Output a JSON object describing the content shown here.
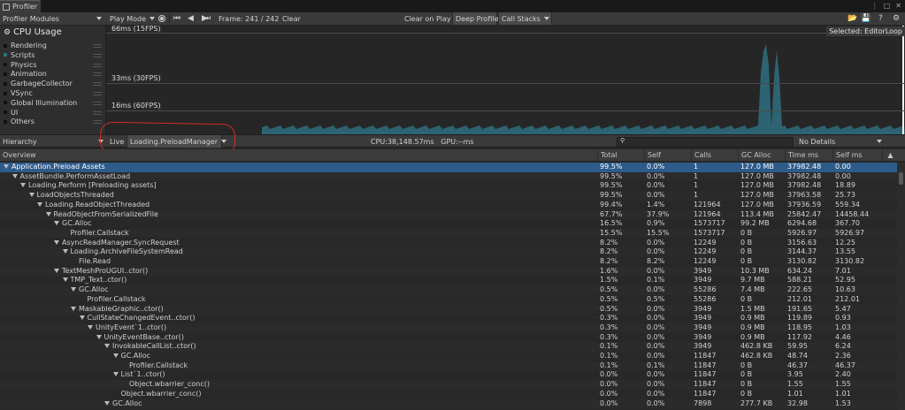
{
  "window": {
    "tab_title": "Profiler"
  },
  "toolbar": {
    "modules_label": "Profiler Modules",
    "play_mode_label": "Play Mode",
    "frame_label": "Frame: 241 / 242",
    "clear_label": "Clear",
    "clear_on_play_label": "Clear on Play",
    "deep_profile_label": "Deep Profile",
    "call_stacks_label": "Call Stacks"
  },
  "cpu_panel": {
    "title": "CPU Usage",
    "legend": [
      "Rendering",
      "Scripts",
      "Physics",
      "Animation",
      "GarbageCollector",
      "VSync",
      "Global Illumination",
      "UI",
      "Others"
    ]
  },
  "graph": {
    "label_66": "66ms (15FPS)",
    "label_33": "33ms (30FPS)",
    "label_16": "16ms (60FPS)",
    "selected_label": "Selected: EditorLoop",
    "bar_color": "#2f6f80"
  },
  "hierarchy_toolbar": {
    "view_label": "Hierarchy",
    "live_label": "Live",
    "thread_label": "Loading.PreloadManager",
    "cpu_stat": "CPU:38,148.57ms   GPU:--ms",
    "details_label": "No Details"
  },
  "columns": [
    "Overview",
    "Total",
    "Self",
    "Calls",
    "GC Alloc",
    "Time ms",
    "Self ms"
  ],
  "rows": [
    {
      "name": "Application.Preload Assets",
      "level": 0,
      "arrow": true,
      "total": "99.5%",
      "self": "0.0%",
      "calls": "1",
      "gc": "127.0 MB",
      "time": "37982.48",
      "selfms": "0.00"
    },
    {
      "name": "AssetBundle.PerformAssetLoad",
      "level": 1,
      "arrow": true,
      "total": "99.5%",
      "self": "0.0%",
      "calls": "1",
      "gc": "127.0 MB",
      "time": "37982.48",
      "selfms": "0.00"
    },
    {
      "name": "Loading.Perform [Preloading assets]",
      "level": 2,
      "arrow": true,
      "total": "99.5%",
      "self": "0.0%",
      "calls": "1",
      "gc": "127.0 MB",
      "time": "37982.48",
      "selfms": "18.89"
    },
    {
      "name": "LoadObjectsThreaded",
      "level": 3,
      "arrow": true,
      "total": "99.5%",
      "self": "0.0%",
      "calls": "1",
      "gc": "127.0 MB",
      "time": "37963.58",
      "selfms": "25.73"
    },
    {
      "name": "Loading.ReadObjectThreaded",
      "level": 4,
      "arrow": true,
      "total": "99.4%",
      "self": "1.4%",
      "calls": "121964",
      "gc": "127.0 MB",
      "time": "37936.59",
      "selfms": "559.34"
    },
    {
      "name": "ReadObjectFromSerializedFile",
      "level": 5,
      "arrow": true,
      "total": "67.7%",
      "self": "37.9%",
      "calls": "121964",
      "gc": "113.4 MB",
      "time": "25842.47",
      "selfms": "14458.44"
    },
    {
      "name": "GC.Alloc",
      "level": 6,
      "arrow": true,
      "total": "16.5%",
      "self": "0.9%",
      "calls": "1573717",
      "gc": "99.2 MB",
      "time": "6294.68",
      "selfms": "367.70"
    },
    {
      "name": "Profiler.Callstack",
      "level": 7,
      "arrow": false,
      "total": "15.5%",
      "self": "15.5%",
      "calls": "1573717",
      "gc": "0 B",
      "time": "5926.97",
      "selfms": "5926.97"
    },
    {
      "name": "AsyncReadManager.SyncRequest",
      "level": 6,
      "arrow": true,
      "total": "8.2%",
      "self": "0.0%",
      "calls": "12249",
      "gc": "0 B",
      "time": "3156.63",
      "selfms": "12.25"
    },
    {
      "name": "Loading.ArchiveFileSystemRead",
      "level": 7,
      "arrow": true,
      "total": "8.2%",
      "self": "0.0%",
      "calls": "12249",
      "gc": "0 B",
      "time": "3144.37",
      "selfms": "13.55"
    },
    {
      "name": "File.Read",
      "level": 8,
      "arrow": false,
      "total": "8.2%",
      "self": "8.2%",
      "calls": "12249",
      "gc": "0 B",
      "time": "3130.82",
      "selfms": "3130.82"
    },
    {
      "name": "TextMeshProUGUI..ctor()",
      "level": 6,
      "arrow": true,
      "total": "1.6%",
      "self": "0.0%",
      "calls": "3949",
      "gc": "10.3 MB",
      "time": "634.24",
      "selfms": "7.01"
    },
    {
      "name": "TMP_Text..ctor()",
      "level": 7,
      "arrow": true,
      "total": "1.5%",
      "self": "0.1%",
      "calls": "3949",
      "gc": "9.7 MB",
      "time": "588.21",
      "selfms": "52.95"
    },
    {
      "name": "GC.Alloc",
      "level": 8,
      "arrow": true,
      "total": "0.5%",
      "self": "0.0%",
      "calls": "55286",
      "gc": "7.4 MB",
      "time": "222.65",
      "selfms": "10.63"
    },
    {
      "name": "Profiler.Callstack",
      "level": 9,
      "arrow": false,
      "total": "0.5%",
      "self": "0.5%",
      "calls": "55286",
      "gc": "0 B",
      "time": "212.01",
      "selfms": "212.01"
    },
    {
      "name": "MaskableGraphic..ctor()",
      "level": 8,
      "arrow": true,
      "total": "0.5%",
      "self": "0.0%",
      "calls": "3949",
      "gc": "1.5 MB",
      "time": "191.65",
      "selfms": "5.47"
    },
    {
      "name": "CullStateChangedEvent..ctor()",
      "level": 9,
      "arrow": true,
      "total": "0.3%",
      "self": "0.0%",
      "calls": "3949",
      "gc": "0.9 MB",
      "time": "119.89",
      "selfms": "0.93"
    },
    {
      "name": "UnityEvent`1..ctor()",
      "level": 10,
      "arrow": true,
      "total": "0.3%",
      "self": "0.0%",
      "calls": "3949",
      "gc": "0.9 MB",
      "time": "118.95",
      "selfms": "1.03"
    },
    {
      "name": "UnityEventBase..ctor()",
      "level": 11,
      "arrow": true,
      "total": "0.3%",
      "self": "0.0%",
      "calls": "3949",
      "gc": "0.9 MB",
      "time": "117.92",
      "selfms": "4.46"
    },
    {
      "name": "InvokableCallList..ctor()",
      "level": 12,
      "arrow": true,
      "total": "0.1%",
      "self": "0.0%",
      "calls": "3949",
      "gc": "462.8 KB",
      "time": "59.95",
      "selfms": "6.24"
    },
    {
      "name": "GC.Alloc",
      "level": 13,
      "arrow": true,
      "total": "0.1%",
      "self": "0.0%",
      "calls": "11847",
      "gc": "462.8 KB",
      "time": "48.74",
      "selfms": "2.36"
    },
    {
      "name": "Profiler.Callstack",
      "level": 14,
      "arrow": false,
      "total": "0.1%",
      "self": "0.1%",
      "calls": "11847",
      "gc": "0 B",
      "time": "46.37",
      "selfms": "46.37"
    },
    {
      "name": "List`1..ctor()",
      "level": 13,
      "arrow": true,
      "total": "0.0%",
      "self": "0.0%",
      "calls": "11847",
      "gc": "0 B",
      "time": "3.95",
      "selfms": "2.40"
    },
    {
      "name": "Object.wbarrier_conc()",
      "level": 14,
      "arrow": false,
      "total": "0.0%",
      "self": "0.0%",
      "calls": "11847",
      "gc": "0 B",
      "time": "1.55",
      "selfms": "1.55"
    },
    {
      "name": "Object.wbarrier_conc()",
      "level": 13,
      "arrow": false,
      "total": "0.0%",
      "self": "0.0%",
      "calls": "11847",
      "gc": "0 B",
      "time": "1.01",
      "selfms": "1.01"
    },
    {
      "name": "GC.Alloc",
      "level": 12,
      "arrow": true,
      "total": "0.0%",
      "self": "0.0%",
      "calls": "7898",
      "gc": "277.7 KB",
      "time": "32.98",
      "selfms": "1.53"
    }
  ]
}
